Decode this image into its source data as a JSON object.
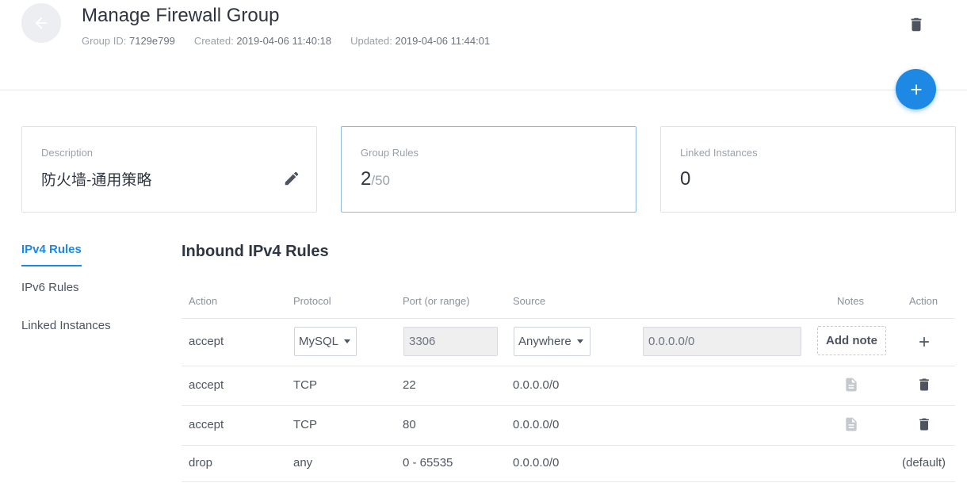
{
  "header": {
    "title": "Manage Firewall Group",
    "group_id_label": "Group ID:",
    "group_id": "7129e799",
    "created_label": "Created:",
    "created": "2019-04-06 11:40:18",
    "updated_label": "Updated:",
    "updated": "2019-04-06 11:44:01"
  },
  "cards": {
    "description": {
      "label": "Description",
      "value": "防火墙-通用策略"
    },
    "group_rules": {
      "label": "Group Rules",
      "count": "2",
      "max": "/50"
    },
    "linked_instances": {
      "label": "Linked Instances",
      "value": "0"
    }
  },
  "sidenav": {
    "items": [
      {
        "label": "IPv4 Rules",
        "active": true
      },
      {
        "label": "IPv6 Rules",
        "active": false
      },
      {
        "label": "Linked Instances",
        "active": false
      }
    ]
  },
  "section": {
    "title": "Inbound IPv4 Rules"
  },
  "table": {
    "headers": {
      "action": "Action",
      "protocol": "Protocol",
      "port": "Port (or range)",
      "source": "Source",
      "notes": "Notes",
      "action2": "Action"
    },
    "new_rule": {
      "action": "accept",
      "protocol_selected": "MySQL",
      "port": "3306",
      "source_selected": "Anywhere",
      "source_value": "0.0.0.0/0",
      "note_button": "Add note"
    },
    "rows": [
      {
        "action": "accept",
        "protocol": "TCP",
        "port": "22",
        "source": "0.0.0.0/0"
      },
      {
        "action": "accept",
        "protocol": "TCP",
        "port": "80",
        "source": "0.0.0.0/0"
      },
      {
        "action": "drop",
        "protocol": "any",
        "port": "0 - 65535",
        "source": "0.0.0.0/0",
        "default_label": "(default)"
      }
    ]
  },
  "colors": {
    "accent": "#1e88e5",
    "text": "#2f3540",
    "muted": "#9aa1ab"
  },
  "icons": {
    "back": "arrow-left-icon",
    "delete": "trash-icon",
    "add": "plus-icon",
    "edit": "pencil-icon",
    "note": "document-icon"
  }
}
